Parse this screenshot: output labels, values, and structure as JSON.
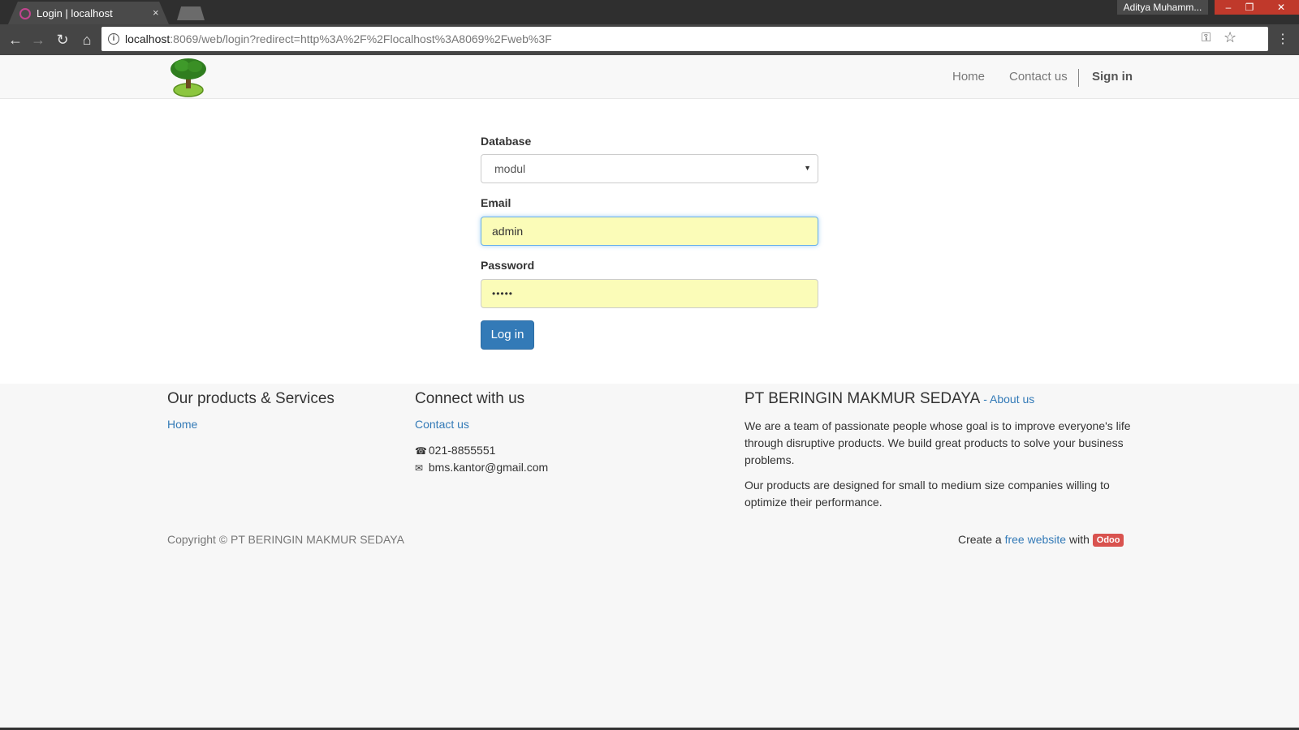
{
  "browser": {
    "tab_title": "Login | localhost",
    "tab_close": "×",
    "profile_name": "Aditya Muhamm...",
    "window_controls": {
      "minimize": "‒",
      "maximize": "❐",
      "close": "✕"
    },
    "url_host": "localhost",
    "url_rest": ":8069/web/login?redirect=http%3A%2F%2Flocalhost%3A8069%2Fweb%3F",
    "icons": [
      "back-arrow-icon",
      "forward-arrow-icon",
      "reload-icon",
      "home-icon",
      "info-icon",
      "key-icon",
      "star-icon",
      "menu-dots-icon"
    ]
  },
  "header": {
    "nav": {
      "home": "Home",
      "contact": "Contact us",
      "signin": "Sign in"
    }
  },
  "login": {
    "database_label": "Database",
    "database_value": "modul",
    "email_label": "Email",
    "email_value": "admin",
    "password_label": "Password",
    "password_value": "•••••",
    "submit_label": "Log in",
    "accent_color": "#337ab7",
    "autofill_color": "#fbfcb8"
  },
  "footer": {
    "products_heading": "Our products & Services",
    "products_link": "Home",
    "connect_heading": "Connect with us",
    "contact_link": "Contact us",
    "phone": "021-8855551",
    "email": "bms.kantor@gmail.com",
    "company_name": "PT BERINGIN MAKMUR SEDAYA",
    "about_dash": " - ",
    "about_link": "About us",
    "about_p1": "We are a team of passionate people whose goal is to improve everyone's life through disruptive products. We build great products to solve your business problems.",
    "about_p2": "Our products are designed for small to medium size companies willing to optimize their performance.",
    "copyright": "Copyright © PT BERINGIN MAKMUR SEDAYA",
    "powered_prefix": "Create a ",
    "powered_link": "free website",
    "powered_mid": " with ",
    "powered_badge": "Odoo",
    "badge_color": "#d9534f"
  }
}
